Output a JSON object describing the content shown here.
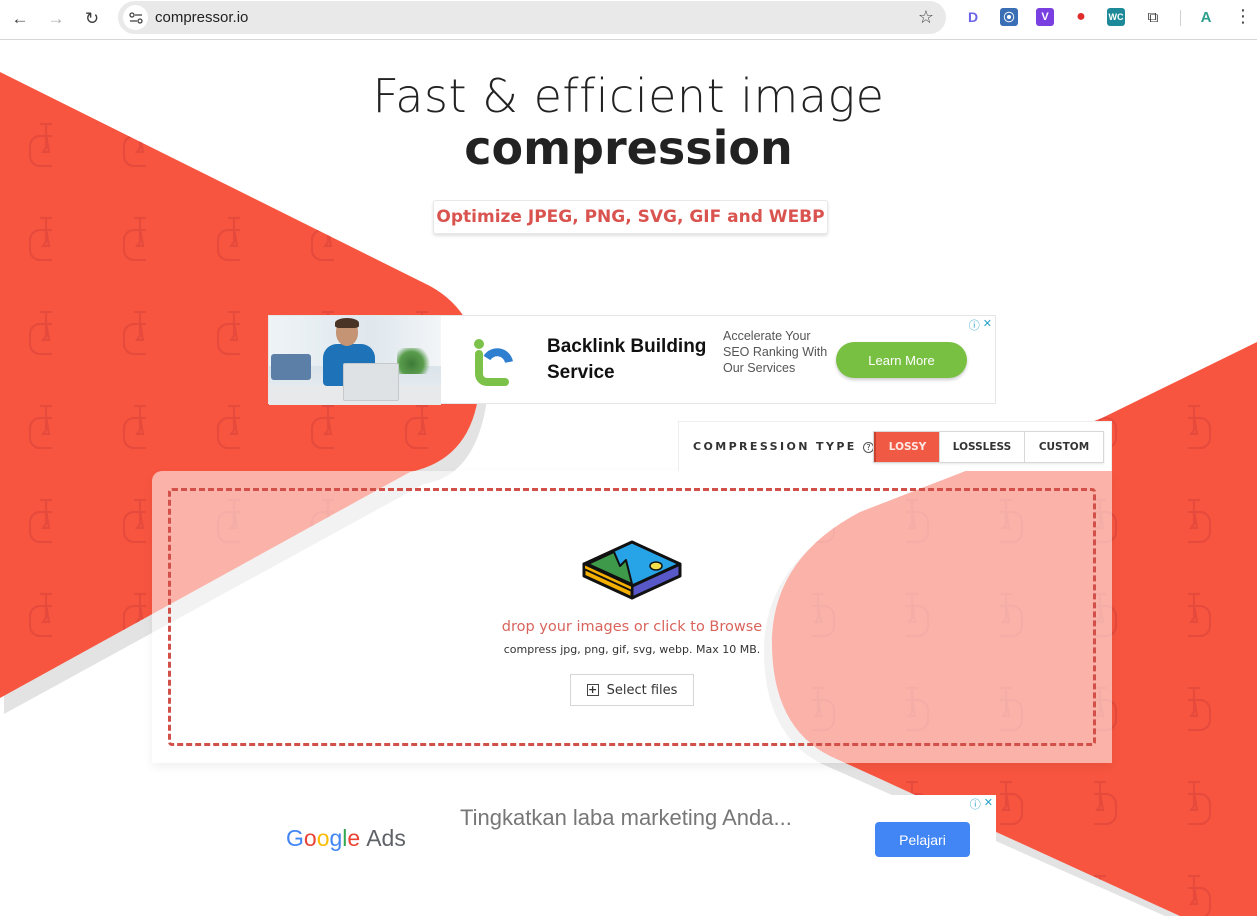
{
  "browser": {
    "url": "compressor.io",
    "nav": {
      "back": "←",
      "forward": "→",
      "reload": "↻"
    },
    "icons": [
      "back-arrow-icon",
      "forward-arrow-icon",
      "reload-icon",
      "site-settings-icon",
      "bookmark-star-icon"
    ],
    "extensions": [
      {
        "name": "extension-d-icon",
        "glyph": "D",
        "color": "#6b63e8"
      },
      {
        "name": "extension-rss-icon",
        "glyph": "⦿",
        "color": "#3a6fb5"
      },
      {
        "name": "extension-v-icon",
        "glyph": "V",
        "color": "#7a3fe0"
      },
      {
        "name": "extension-record-icon",
        "glyph": "●",
        "color": "#e02b2b"
      },
      {
        "name": "extension-wc-icon",
        "glyph": "WC",
        "color": "#1e8a99"
      },
      {
        "name": "extensions-puzzle-icon",
        "glyph": "⧉",
        "color": "#444444"
      },
      {
        "name": "profile-avatar-icon",
        "glyph": "A",
        "color": "#2e9f8c"
      }
    ],
    "menu_glyph": "⋮"
  },
  "hero": {
    "title_line1": "Fast & efficient image",
    "title_line2": "compression",
    "subtitle": "Optimize JPEG, PNG, SVG, GIF and WEBP"
  },
  "ad_top": {
    "headline": "Backlink Building Service",
    "description": "Accelerate Your SEO Ranking With Our Services",
    "cta": "Learn More",
    "info_glyph": "ⓘ",
    "close_glyph": "✕"
  },
  "compression": {
    "label": "COMPRESSION TYPE",
    "help_glyph": "?",
    "colon": ":",
    "options": [
      {
        "label": "LOSSY",
        "active": true
      },
      {
        "label": "LOSSLESS",
        "active": false
      },
      {
        "label": "CUSTOM",
        "active": false
      }
    ]
  },
  "upload": {
    "title": "drop your images or click to Browse",
    "subtitle": "compress jpg, png, gif, svg, webp. Max 10 MB.",
    "button_label": "Select files",
    "button_glyph": "+"
  },
  "ad_bottom": {
    "brand_google": "Google",
    "brand_ads": "Ads",
    "text": "Tingkatkan laba marketing Anda...",
    "cta": "Pelajari",
    "info_glyph": "ⓘ",
    "close_glyph": "✕"
  },
  "colors": {
    "brand_red": "#f7553f",
    "accent_text": "#d9534f",
    "learn_more_green": "#78c042",
    "google_blue": "#4285f4"
  }
}
